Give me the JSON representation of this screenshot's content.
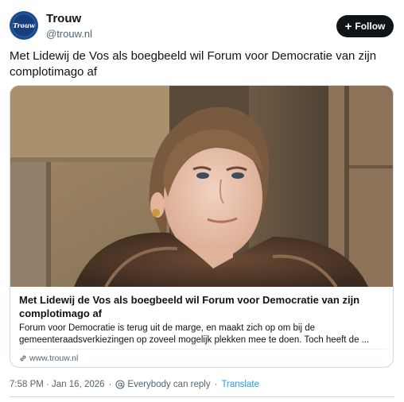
{
  "account": {
    "display_name": "Trouw",
    "handle": "@trouw.nl",
    "avatar_text": "Trouw"
  },
  "follow_button": {
    "label": "Follow",
    "icon": "plus-icon"
  },
  "post": {
    "text": "Met Lidewij de Vos als boegbeeld wil Forum voor Democratie van zijn complotimago af"
  },
  "card": {
    "title": "Met Lidewij de Vos als boegbeeld wil Forum voor Democratie van zijn complotimago af",
    "description": "Forum voor Democratie is terug uit de marge, en maakt zich op om bij de gemeenteraadsverkiezingen op zoveel mogelijk plekken mee te doen. Toch heeft de ...",
    "domain": "www.trouw.nl",
    "domain_icon": "link-icon"
  },
  "meta": {
    "timestamp": "7:58 PM · Jan 16, 2026",
    "reply_setting": "Everybody can reply",
    "reply_icon": "at-icon",
    "translate_label": "Translate"
  },
  "colors": {
    "follow_bg": "#0f1419",
    "link": "#1d9bf0",
    "muted": "#536471",
    "avatar": "#1a4a8a"
  }
}
